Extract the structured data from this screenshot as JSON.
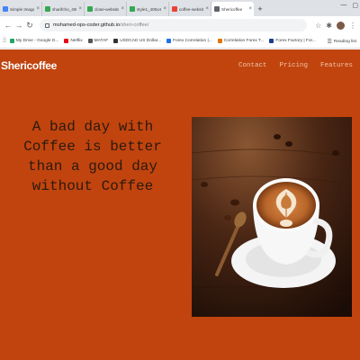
{
  "browser": {
    "tabs": [
      {
        "title": "Simple Image Resizer",
        "favicon_color": "#4285f4"
      },
      {
        "title": "sharifcho_400x400.png",
        "favicon_color": "#34a853"
      },
      {
        "title": "close-website_400x400",
        "favicon_color": "#34a853"
      },
      {
        "title": "style1_400x400.png",
        "favicon_color": "#34a853"
      },
      {
        "title": "coffee-website - mohar",
        "favicon_color": "#ea4335"
      },
      {
        "title": "Shericoffee",
        "favicon_color": "#5f6368"
      }
    ],
    "new_tab_label": "+",
    "url_host": "mohamed-ops-coder.github.io",
    "url_path": "/sheri-coffee/",
    "bookmarks": [
      {
        "label": "My Drive - Google D...",
        "color": "#1fa463"
      },
      {
        "label": "Netflix",
        "color": "#e50914"
      },
      {
        "label": "MATAF",
        "color": "#555555"
      },
      {
        "label": "USDCAD US Dollar...",
        "color": "#333333"
      },
      {
        "label": "Forex Correlation |...",
        "color": "#1a73e8"
      },
      {
        "label": "Correlation Forex T...",
        "color": "#e37400"
      },
      {
        "label": "Forex Factory | For...",
        "color": "#1a3e8c"
      }
    ],
    "reading_list": "Reading list"
  },
  "site": {
    "brand": "Shericoffee",
    "nav": [
      "Contact",
      "Pricing",
      "Features"
    ],
    "hero_text": "A bad day with Coffee is better than a good day without Coffee",
    "background_color": "#c1440e",
    "hero_image": "coffee-cup-latte-art"
  }
}
